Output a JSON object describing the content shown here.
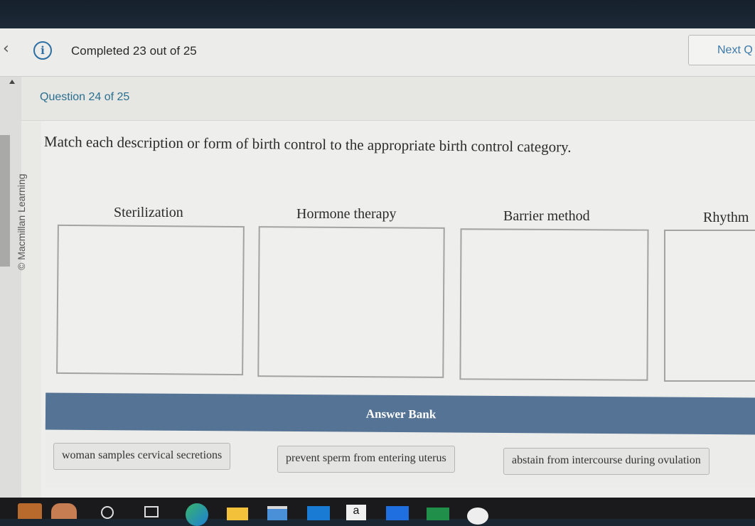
{
  "header": {
    "back_icon": "chevron-left-icon",
    "info_icon": "info-icon",
    "info_glyph": "i",
    "completed_text": "Completed 23 out of 25",
    "next_button": "Next Q"
  },
  "sidebar": {
    "copyright": "© Macmillan Learning",
    "scroll_up_icon": "triangle-up-icon"
  },
  "question": {
    "number_text": "Question 24 of 25",
    "prompt": "Match each description or form of birth control to the appropriate birth control category.",
    "categories": [
      {
        "label": "Sterilization"
      },
      {
        "label": "Hormone therapy"
      },
      {
        "label": "Barrier method"
      },
      {
        "label": "Rhythm"
      }
    ]
  },
  "answer_bank": {
    "title": "Answer Bank",
    "items": [
      {
        "label": "woman samples cervical secretions"
      },
      {
        "label": "prevent sperm from entering uterus"
      },
      {
        "label": "abstain from intercourse during ovulation"
      }
    ]
  },
  "taskbar": {
    "icons": [
      "widgets-icon",
      "search-icon",
      "task-view-icon",
      "edge-icon",
      "file-explorer-icon",
      "store-icon",
      "mail-icon",
      "amazon-icon",
      "dropbox-icon",
      "excel-icon",
      "chrome-icon"
    ]
  }
}
